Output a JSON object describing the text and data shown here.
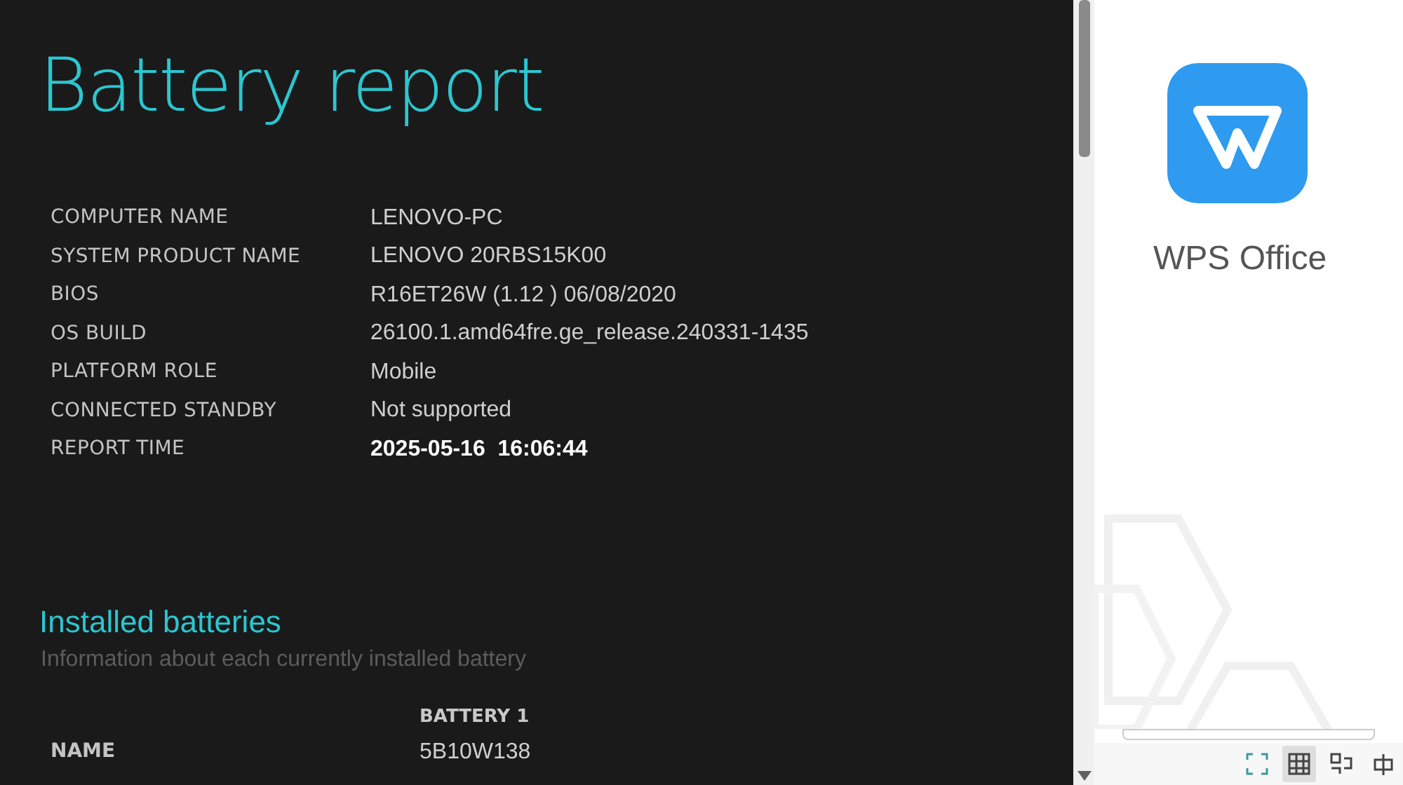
{
  "report": {
    "title": "Battery report",
    "system_info": [
      {
        "label": "COMPUTER NAME",
        "value": "LENOVO-PC",
        "emphasis": false
      },
      {
        "label": "SYSTEM PRODUCT NAME",
        "value": "LENOVO 20RBS15K00",
        "emphasis": false
      },
      {
        "label": "BIOS",
        "value": "R16ET26W (1.12 ) 06/08/2020",
        "emphasis": false
      },
      {
        "label": "OS BUILD",
        "value": "26100.1.amd64fre.ge_release.240331-1435",
        "emphasis": false
      },
      {
        "label": "PLATFORM ROLE",
        "value": "Mobile",
        "emphasis": false
      },
      {
        "label": "CONNECTED STANDBY",
        "value": "Not supported",
        "emphasis": false
      },
      {
        "label": "REPORT TIME",
        "value": "2025-05-16  16:06:44",
        "emphasis": true
      }
    ],
    "installed_batteries": {
      "heading": "Installed batteries",
      "subtitle": "Information about each currently installed battery",
      "columns": [
        "BATTERY 1"
      ],
      "rows": [
        {
          "label": "NAME",
          "values": [
            "5B10W138"
          ]
        }
      ]
    }
  },
  "side_panel": {
    "app_name": "WPS Office"
  },
  "toolbar": [
    {
      "kind": "fullscreen",
      "selected": false
    },
    {
      "kind": "grid",
      "selected": true
    },
    {
      "kind": "layout",
      "selected": false
    },
    {
      "kind": "split",
      "selected": false
    }
  ]
}
